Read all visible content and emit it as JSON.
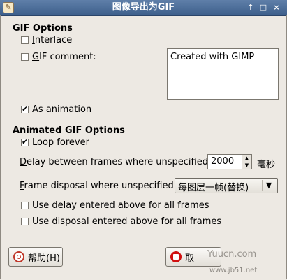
{
  "window": {
    "title": "图像导出为GIF",
    "pin_glyph": "↑",
    "maximize_glyph": "□",
    "close_glyph": "×"
  },
  "gif_options": {
    "heading": "GIF Options",
    "interlace": {
      "mnemonic": "I",
      "rest": "nterlace",
      "checked": false
    },
    "gif_comment": {
      "mnemonic": "G",
      "rest": "IF comment:",
      "checked": false
    },
    "comment_text": "Created with GIMP",
    "as_animation": {
      "prefix": "As ",
      "mnemonic": "a",
      "rest": "nimation",
      "checked": true
    }
  },
  "animated_options": {
    "heading": "Animated GIF Options",
    "loop_forever": {
      "mnemonic": "L",
      "rest": "oop forever",
      "checked": true
    },
    "delay_label": {
      "mnemonic": "D",
      "rest": "elay between frames where unspecified:"
    },
    "delay_value": "2000",
    "delay_unit": "毫秒",
    "disposal_label": {
      "mnemonic": "F",
      "rest": "rame disposal where unspecified:"
    },
    "disposal_value": "每图层一帧(替换)",
    "use_delay": {
      "mnemonic": "U",
      "rest": "se delay entered above for all frames",
      "checked": false
    },
    "use_disposal": {
      "prefix": "U",
      "mnemonic": "s",
      "rest": "e disposal entered above for all frames",
      "checked": false
    }
  },
  "buttons": {
    "help_label": "帮助(",
    "help_mnemonic": "H",
    "help_suffix": ")",
    "cancel_label": "取"
  },
  "watermark": {
    "brand": "Yuucn.com",
    "site": "www.jb51.net"
  }
}
